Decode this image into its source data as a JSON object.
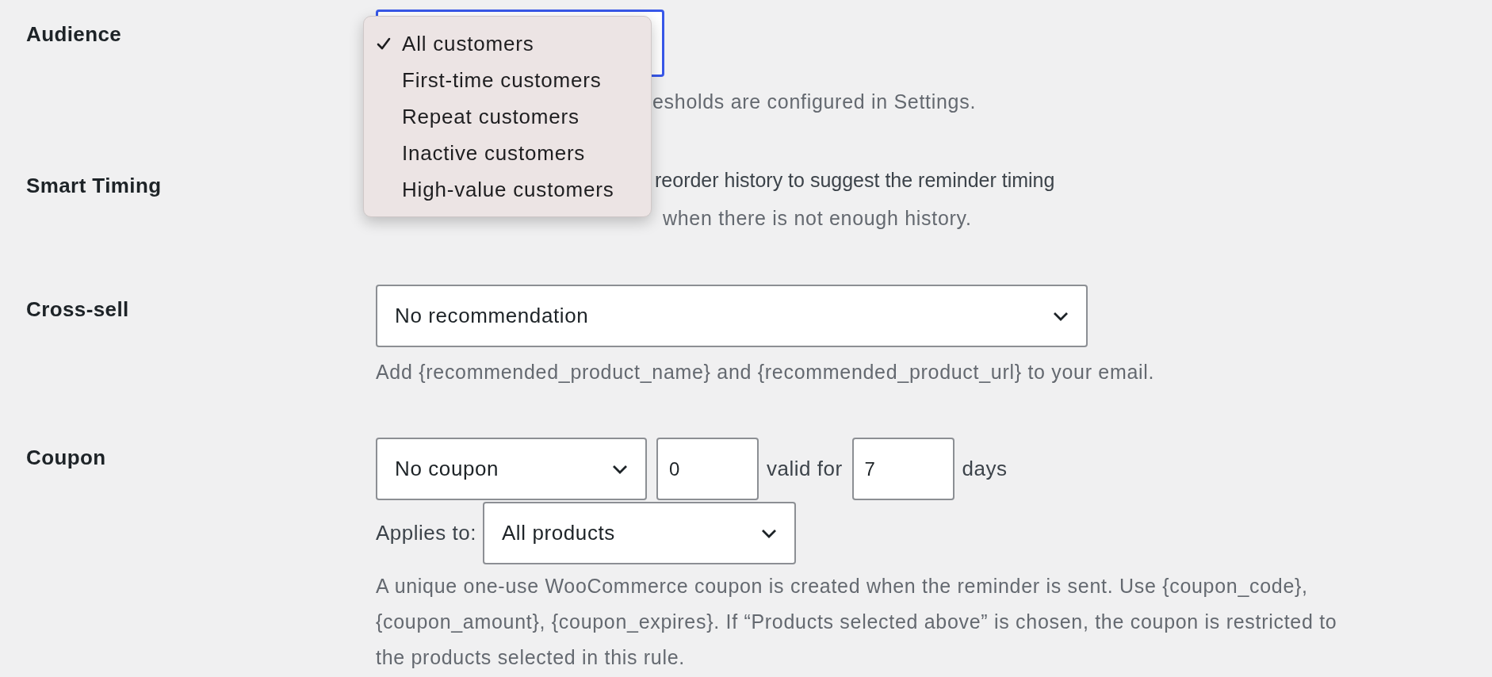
{
  "audience": {
    "label": "Audience",
    "focused": true,
    "menu": [
      {
        "label": "All customers",
        "selected": true
      },
      {
        "label": "First-time customers",
        "selected": false
      },
      {
        "label": "Repeat customers",
        "selected": false
      },
      {
        "label": "Inactive customers",
        "selected": false
      },
      {
        "label": "High-value customers",
        "selected": false
      }
    ],
    "description": "esholds are configured in Settings."
  },
  "smart_timing": {
    "label": "Smart Timing",
    "description": "reorder history to suggest the reminder timing",
    "note": "when there is not enough history."
  },
  "cross_sell": {
    "label": "Cross-sell",
    "select": "No recommendation",
    "description": "Add {recommended_product_name} and {recommended_product_url} to your email."
  },
  "coupon": {
    "label": "Coupon",
    "type_select": "No coupon",
    "amount": "0",
    "valid_for_label": "valid for",
    "days_value": "7",
    "days_label": "days",
    "applies_label": "Applies to:",
    "applies_select": "All products",
    "description": "A unique one-use WooCommerce coupon is created when the reminder is sent. Use {coupon_code}, {coupon_amount}, {coupon_expires}. If “Products selected above” is chosen, the coupon is restricted to the products selected in this rule."
  }
}
